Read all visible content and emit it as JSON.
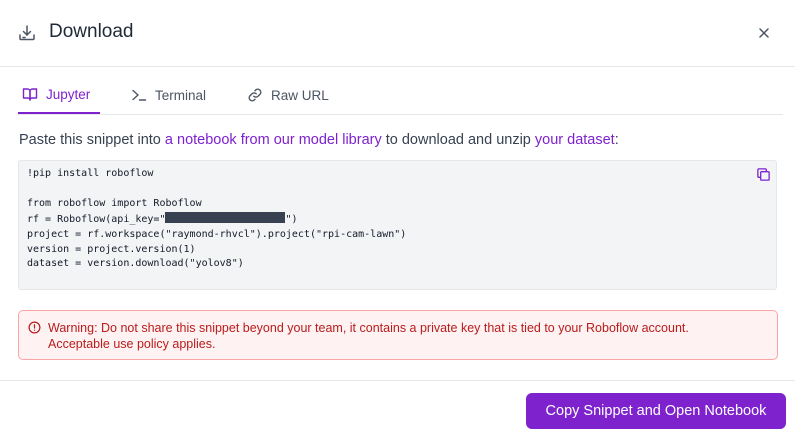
{
  "dialog": {
    "title": "Download",
    "header_icon": "download-icon",
    "close_icon": "close-icon"
  },
  "tabs": [
    {
      "label": "Jupyter",
      "icon": "book-icon",
      "active": true
    },
    {
      "label": "Terminal",
      "icon": "terminal-icon",
      "active": false
    },
    {
      "label": "Raw URL",
      "icon": "link-icon",
      "active": false
    }
  ],
  "instructions": {
    "prefix": "Paste this snippet into ",
    "link1": "a notebook from our model library",
    "middle": " to download and unzip ",
    "link2": "your dataset",
    "suffix": ":"
  },
  "code": {
    "line1": "!pip install roboflow",
    "line2": "",
    "line3": "from roboflow import Roboflow",
    "line4_prefix": "rf = Roboflow(api_key=\"",
    "line4_suffix": "\")",
    "line5": "project = rf.workspace(\"raymond-rhvcl\").project(\"rpi-cam-lawn\")",
    "line6": "version = project.version(1)",
    "line7": "dataset = version.download(\"yolov8\")",
    "copy_icon": "copy-icon"
  },
  "warning": {
    "icon": "alert-circle-icon",
    "line1": "Warning: Do not share this snippet beyond your team, it contains a private key that is tied to your Roboflow account.",
    "line2": "Acceptable use policy applies."
  },
  "footer": {
    "primary_button": "Copy Snippet and Open Notebook"
  },
  "colors": {
    "accent": "#7e22ce",
    "warning_text": "#b91c1c",
    "warning_bg": "#fef2f2",
    "code_bg": "#f3f4f6"
  }
}
